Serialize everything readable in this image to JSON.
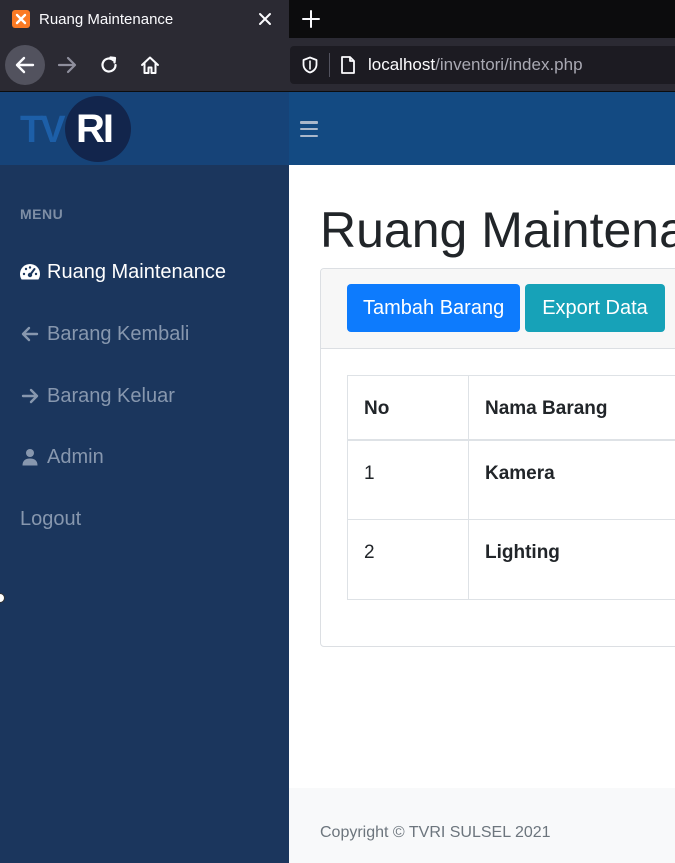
{
  "browser": {
    "tab_title": "Ruang Maintenance",
    "url_host": "localhost",
    "url_path": "/inventori/index.php",
    "icons": {
      "favicon": "xampp-icon",
      "close": "close-icon",
      "new_tab": "plus-icon",
      "back": "arrow-left-icon",
      "forward": "arrow-right-icon",
      "reload": "reload-icon",
      "home": "home-icon",
      "shield": "shield-icon",
      "page": "page-icon"
    }
  },
  "header": {
    "logo_text_tv": "TV",
    "logo_text_ri": "RI",
    "menu_toggle_icon": "hamburger-icon"
  },
  "sidebar": {
    "heading": "MENU",
    "items": [
      {
        "label": "Ruang Maintenance",
        "icon": "tachometer-icon",
        "active": true
      },
      {
        "label": "Barang Kembali",
        "icon": "arrow-left-icon",
        "active": false
      },
      {
        "label": "Barang Keluar",
        "icon": "arrow-right-icon",
        "active": false
      },
      {
        "label": "Admin",
        "icon": "user-icon",
        "active": false
      },
      {
        "label": "Logout",
        "icon": "",
        "active": false
      }
    ]
  },
  "main": {
    "title": "Ruang Maintenance",
    "buttons": {
      "add": "Tambah Barang",
      "export": "Export Data"
    },
    "table": {
      "columns": [
        "No",
        "Nama Barang"
      ],
      "rows": [
        {
          "no": "1",
          "name": "Kamera"
        },
        {
          "no": "2",
          "name": "Lighting"
        }
      ]
    }
  },
  "footer": {
    "text": "Copyright © TVRI SULSEL 2021"
  },
  "colors": {
    "header_bg": "#134a82",
    "sidebar_bg": "#1b365d",
    "primary": "#0d7bfd",
    "info": "#17a2b8"
  }
}
